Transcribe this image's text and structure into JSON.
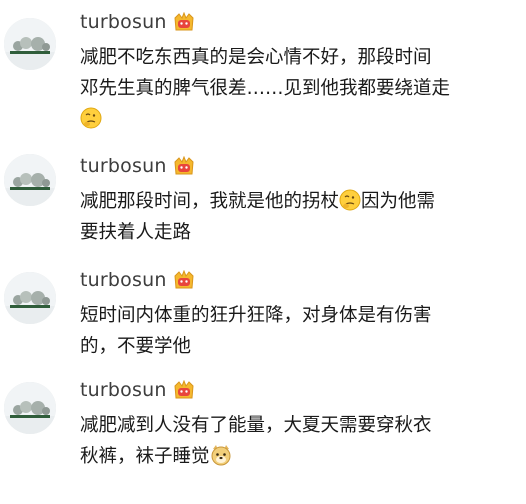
{
  "comments": [
    {
      "username": "turbosun",
      "badge_icon": "crown-badge-icon",
      "lines": [
        "减肥不吃东西真的是会心情不好，那段时间",
        "邓先生真的脾气很差……见到他我都要绕道走"
      ],
      "trailing_emoji": "thinking-face-emoji"
    },
    {
      "username": "turbosun",
      "badge_icon": "crown-badge-icon",
      "line1_before": "减肥那段时间，我就是他的拐杖",
      "line1_emoji": "thinking-face-emoji",
      "line1_after": "因为他需",
      "line2": "要扶着人走路"
    },
    {
      "username": "turbosun",
      "badge_icon": "crown-badge-icon",
      "lines": [
        "短时间内体重的狂升狂降，对身体是有伤害",
        "的，不要学他"
      ]
    },
    {
      "username": "turbosun",
      "badge_icon": "crown-badge-icon",
      "line1": "减肥减到人没有了能量，大夏天需要穿秋衣",
      "line2_before": "秋裤，袜子睡觉",
      "line2_emoji": "doge-emoji"
    }
  ],
  "colors": {
    "username": "#3d3d3d",
    "text": "#1a1a1a",
    "crown_fill": "#f5b82e",
    "crown_face": "#e8453c"
  }
}
